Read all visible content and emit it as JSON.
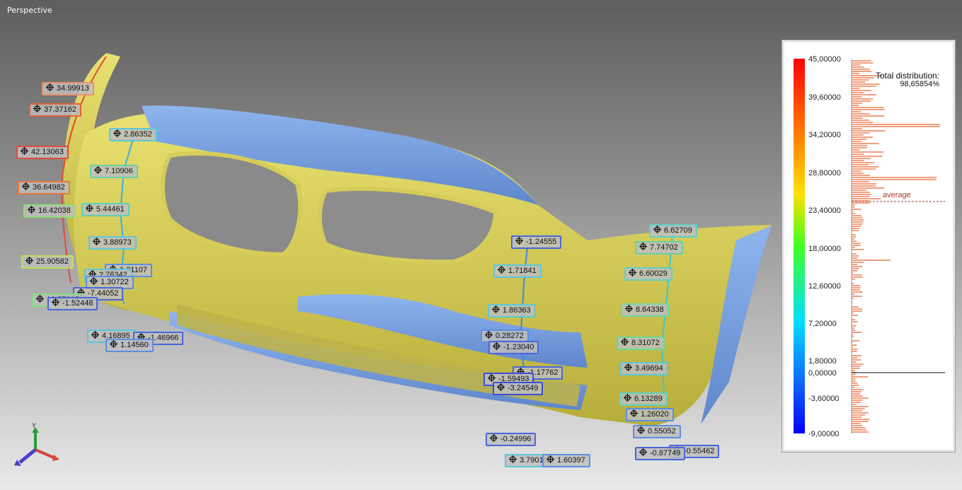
{
  "viewport": {
    "title": "Perspective"
  },
  "callouts": [
    {
      "value": "34.99913",
      "color": "#e8916f"
    },
    {
      "value": "37.37162",
      "color": "#e8603a"
    },
    {
      "value": "2.86352",
      "color": "#5bc7d9"
    },
    {
      "value": "42.13063",
      "color": "#e24a3a"
    },
    {
      "value": "7.10906",
      "color": "#68d0a5"
    },
    {
      "value": "36.64982",
      "color": "#e8763c"
    },
    {
      "value": "16.42038",
      "color": "#8fe07a"
    },
    {
      "value": "5.44461",
      "color": "#5fd0b8"
    },
    {
      "value": "3.88973",
      "color": "#5bc7d9"
    },
    {
      "value": "25.90582",
      "color": "#b9e25a"
    },
    {
      "value": "1.31107",
      "color": "#5b8fe0"
    },
    {
      "value": "2.76342",
      "color": "#5bc7d9"
    },
    {
      "value": "1.30722",
      "color": "#5b8fe0"
    },
    {
      "value": "-7.44052",
      "color": "#4a67d8"
    },
    {
      "value": "12.57015",
      "color": "#7fe07a"
    },
    {
      "value": "-1.52448",
      "color": "#4a67d8"
    },
    {
      "value": "4.16895",
      "color": "#5bc7d9"
    },
    {
      "value": "-1.46966",
      "color": "#4a67d8"
    },
    {
      "value": "1.14560",
      "color": "#5b8fe0"
    },
    {
      "value": "-1.24555",
      "color": "#4a67d8"
    },
    {
      "value": "1.71841",
      "color": "#5bc7d9"
    },
    {
      "value": "1.86363",
      "color": "#5bc7d9"
    },
    {
      "value": "0.28272",
      "color": "#5b8fe0"
    },
    {
      "value": "-1.23040",
      "color": "#4a67d8"
    },
    {
      "value": "-1.17762",
      "color": "#4a67d8"
    },
    {
      "value": "-1.59493",
      "color": "#3a4ed8"
    },
    {
      "value": "-3.24549",
      "color": "#3a4ed8"
    },
    {
      "value": "-0.24996",
      "color": "#4a67d8"
    },
    {
      "value": "3.79010",
      "color": "#5bc7d9"
    },
    {
      "value": "1.60397",
      "color": "#5b8fe0"
    },
    {
      "value": "6.62709",
      "color": "#5fd0c6"
    },
    {
      "value": "7.74702",
      "color": "#68d0a5"
    },
    {
      "value": "6.60029",
      "color": "#5fd0c6"
    },
    {
      "value": "8.64338",
      "color": "#6cd89a"
    },
    {
      "value": "8.31072",
      "color": "#6cd89a"
    },
    {
      "value": "3.49694",
      "color": "#5bc7d9"
    },
    {
      "value": "6.13289",
      "color": "#5fd0c6"
    },
    {
      "value": "1.26020",
      "color": "#5b8fe0"
    },
    {
      "value": "0.55052",
      "color": "#5b8fe0"
    },
    {
      "value": "-0.55462",
      "color": "#4a67d8"
    },
    {
      "value": "-0.87749",
      "color": "#4a67d8"
    }
  ],
  "legend": {
    "scale_labels": [
      "45,00000",
      "39,60000",
      "34,20000",
      "28,80000",
      "23,40000",
      "18,00000",
      "12,60000",
      "7,20000",
      "1,80000",
      "0,00000",
      "-3,60000",
      "-9,00000"
    ],
    "total_title": "Total distribution:",
    "total_value": "98,65854%",
    "average_label": "average",
    "histogram_color": "#f0a080",
    "average_color": "#a03030"
  },
  "axis_gizmo": {
    "y_label": "Y"
  }
}
